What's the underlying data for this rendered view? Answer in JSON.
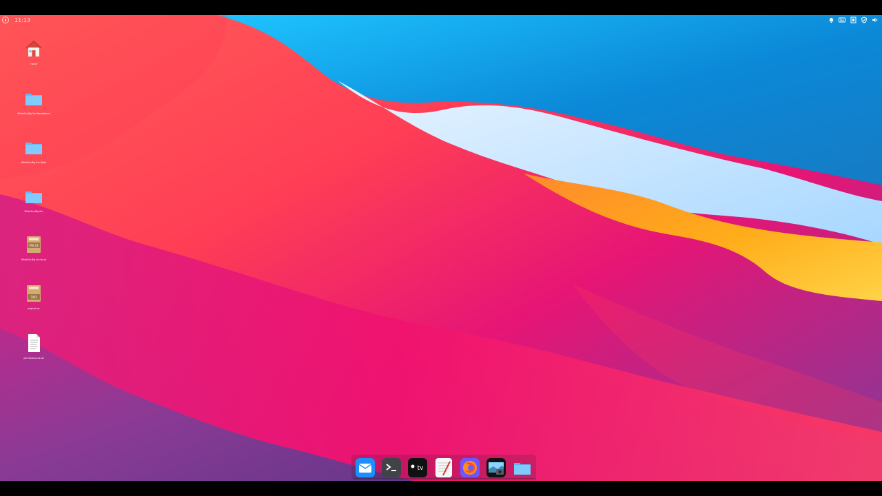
{
  "topbar": {
    "time": "11:13",
    "launcher_icon": "system-logo-icon",
    "tray_icons": [
      "bell-icon",
      "keyboard-icon",
      "battery-icon",
      "shield-icon",
      "volume-icon"
    ]
  },
  "desktop": {
    "items": [
      {
        "name": "home",
        "icon": "home-icon",
        "label": "Home"
      },
      {
        "name": "folder-1",
        "icon": "folder-icon",
        "label": "WhiteSur-Big-Sur-Remastered"
      },
      {
        "name": "folder-2",
        "icon": "folder-icon",
        "label": "WhiteSur-Big-Sur-Night"
      },
      {
        "name": "folder-3",
        "icon": "folder-icon",
        "label": "WhiteSur-Big-Sur"
      },
      {
        "name": "tar-xz",
        "icon": "archive-tar-xz-icon",
        "label": "WhiteSur-Big-Sur.tar.xz",
        "badge": "TAR.XZ"
      },
      {
        "name": "tar",
        "icon": "archive-tar-icon",
        "label": "original.tar",
        "badge": "TAR"
      },
      {
        "name": "text-file",
        "icon": "text-document-icon",
        "label": "permissions-fix.txt"
      }
    ]
  },
  "dock": {
    "apps": [
      {
        "name": "mail",
        "icon": "mail-icon"
      },
      {
        "name": "terminal",
        "icon": "terminal-icon"
      },
      {
        "name": "apple-tv",
        "icon": "apple-tv-icon",
        "label": "tv"
      },
      {
        "name": "text-editor",
        "icon": "text-editor-icon"
      },
      {
        "name": "firefox",
        "icon": "firefox-icon"
      },
      {
        "name": "screenshot",
        "icon": "screenshot-icon"
      },
      {
        "name": "files",
        "icon": "folder-icon"
      }
    ]
  },
  "colors": {
    "blue": "#0f8fd9",
    "light_blue": "#8ed2ff",
    "coral": "#ff5f5c",
    "magenta": "#e0157a",
    "purple": "#6b3d91",
    "orange": "#ffad1e"
  }
}
